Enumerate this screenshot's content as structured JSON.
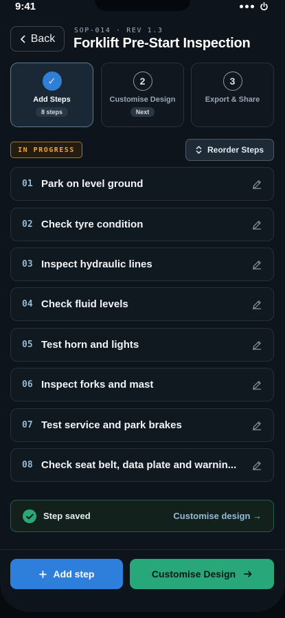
{
  "status_bar": {
    "time": "9:41"
  },
  "header": {
    "back_label": "Back",
    "sop_code": "SOP-014 · REV 1.3",
    "title": "Forklift Pre-Start Inspection"
  },
  "stepper": [
    {
      "number": "✓",
      "label": "Add Steps",
      "badge": "8 steps",
      "active": true
    },
    {
      "number": "2",
      "label": "Customise Design",
      "badge": "Next",
      "active": false
    },
    {
      "number": "3",
      "label": "Export & Share",
      "badge": "",
      "active": false
    }
  ],
  "status_badge": "IN PROGRESS",
  "reorder_label": "Reorder Steps",
  "steps": [
    {
      "num": "01",
      "title": "Park on level ground"
    },
    {
      "num": "02",
      "title": "Check tyre condition"
    },
    {
      "num": "03",
      "title": "Inspect hydraulic lines"
    },
    {
      "num": "04",
      "title": "Check fluid levels"
    },
    {
      "num": "05",
      "title": "Test horn and lights"
    },
    {
      "num": "06",
      "title": "Inspect forks and mast"
    },
    {
      "num": "07",
      "title": "Test service and park brakes"
    },
    {
      "num": "08",
      "title": "Check seat belt, data plate and warnin..."
    }
  ],
  "toast": {
    "message": "Step saved",
    "link": "Customise design →"
  },
  "footer": {
    "add_step_label": "Add step",
    "customise_label": "Customise Design"
  },
  "colors": {
    "primary": "#2e7fdb",
    "success": "#28a77a",
    "warning": "#e8a73c"
  }
}
